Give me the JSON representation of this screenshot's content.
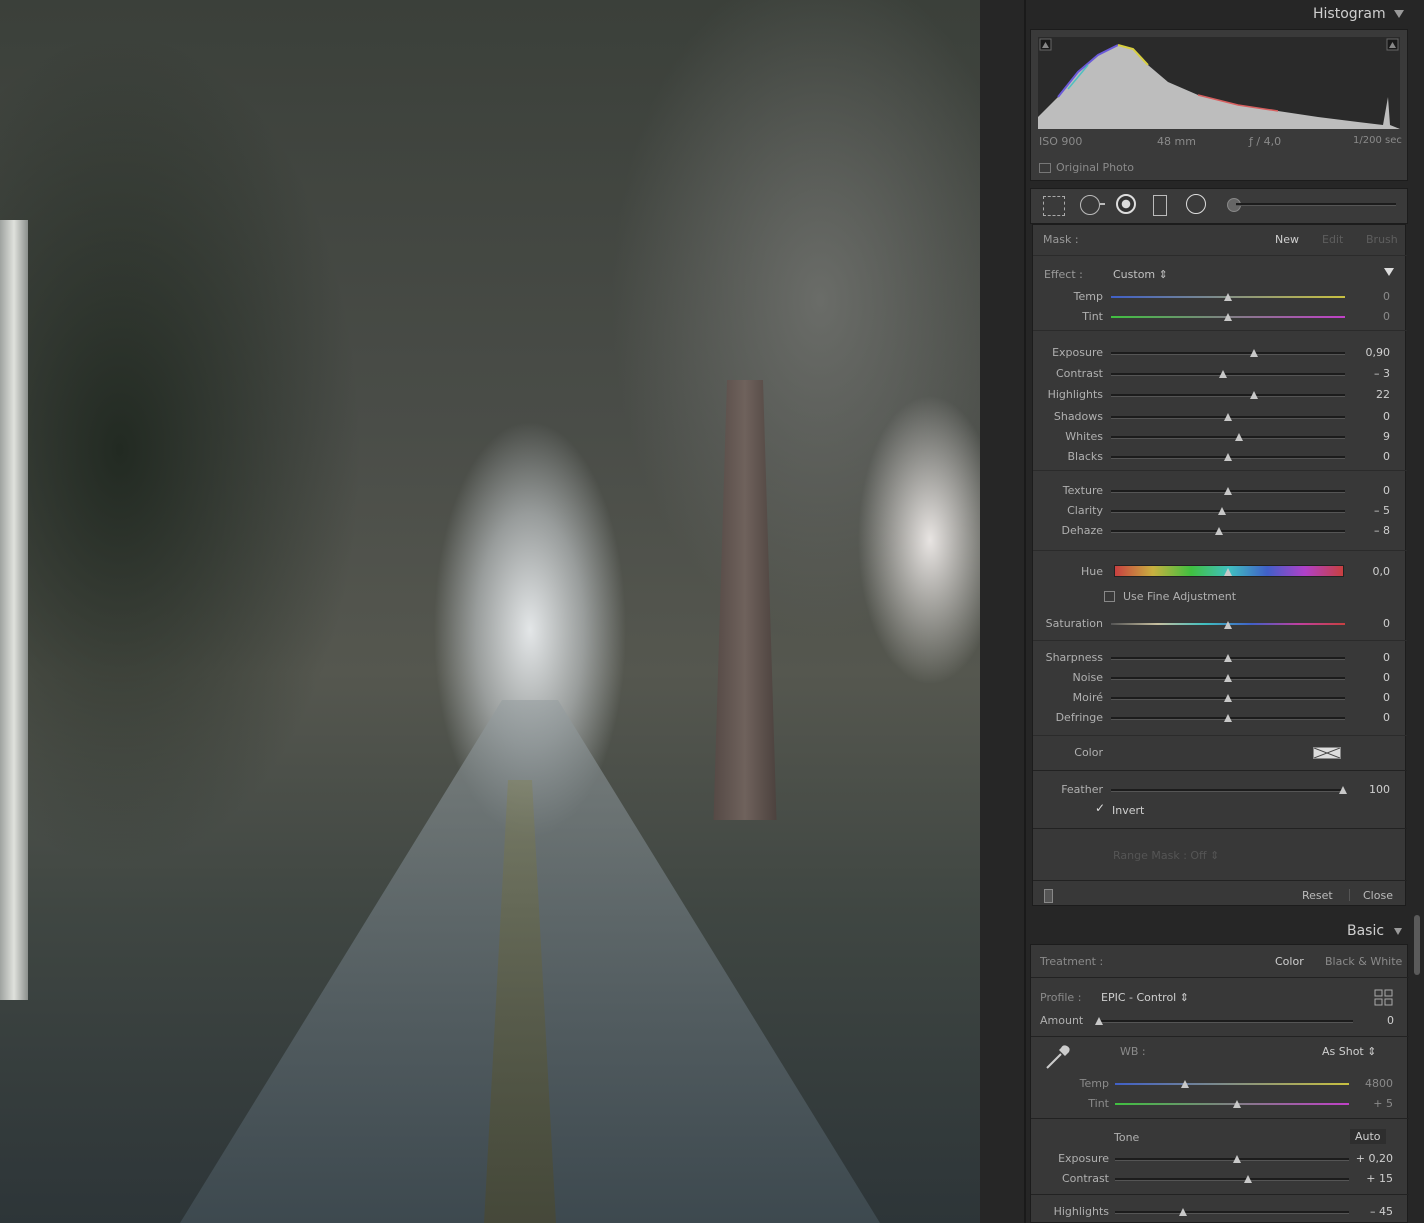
{
  "histogram": {
    "title": "Histogram",
    "iso": "ISO 900",
    "focal": "48 mm",
    "aperture": "ƒ / 4,0",
    "shutter": "1/200 sec",
    "original_photo": "Original Photo"
  },
  "mask": {
    "label": "Mask :",
    "new": "New",
    "edit": "Edit",
    "brush": "Brush"
  },
  "effect": {
    "label": "Effect :",
    "value": "Custom ⇕"
  },
  "sliders": [
    {
      "label": "Temp",
      "value": "0",
      "level": 0.5
    },
    {
      "label": "Tint",
      "value": "0",
      "level": 0.5
    },
    {
      "label": "Exposure",
      "value": "0,90",
      "level": 0.61
    },
    {
      "label": "Contrast",
      "value": "– 3",
      "level": 0.48
    },
    {
      "label": "Highlights",
      "value": "22",
      "level": 0.61
    },
    {
      "label": "Shadows",
      "value": "0",
      "level": 0.5
    },
    {
      "label": "Whites",
      "value": "9",
      "level": 0.545
    },
    {
      "label": "Blacks",
      "value": "0",
      "level": 0.5
    },
    {
      "label": "Texture",
      "value": "0",
      "level": 0.5
    },
    {
      "label": "Clarity",
      "value": "– 5",
      "level": 0.475
    },
    {
      "label": "Dehaze",
      "value": "– 8",
      "level": 0.46
    }
  ],
  "hue": {
    "label": "Hue",
    "value": "0,0",
    "level": 0.5
  },
  "fine_adjustment": "Use Fine Adjustment",
  "saturation": {
    "label": "Saturation",
    "value": "0",
    "level": 0.5
  },
  "detail_sliders": [
    {
      "label": "Sharpness",
      "value": "0",
      "level": 0.5
    },
    {
      "label": "Noise",
      "value": "0",
      "level": 0.5
    },
    {
      "label": "Moiré",
      "value": "0",
      "level": 0.5
    },
    {
      "label": "Defringe",
      "value": "0",
      "level": 0.5
    }
  ],
  "color_label": "Color",
  "feather": {
    "label": "Feather",
    "value": "100",
    "level": 0.99
  },
  "invert": "Invert",
  "range_mask": "Range Mask :  Off  ⇕",
  "footer": {
    "reset": "Reset",
    "close": "Close"
  },
  "basic": {
    "title": "Basic",
    "treatment_label": "Treatment :",
    "color": "Color",
    "bw": "Black & White",
    "profile_label": "Profile :",
    "profile_value": "EPIC - Control ⇕",
    "amount": {
      "label": "Amount",
      "value": "0",
      "level": 0.0
    },
    "wb_label": "WB :",
    "wb_value": "As Shot ⇕",
    "temp": {
      "label": "Temp",
      "value": "4800",
      "level": 0.3
    },
    "tint": {
      "label": "Tint",
      "value": "+ 5",
      "level": 0.52
    },
    "tone_label": "Tone",
    "auto": "Auto",
    "exposure": {
      "label": "Exposure",
      "value": "+ 0,20",
      "level": 0.52
    },
    "contrast": {
      "label": "Contrast",
      "value": "+ 15",
      "level": 0.57
    },
    "highlights": {
      "label": "Highlights",
      "value": "– 45",
      "level": 0.29
    }
  },
  "colors": {
    "panel_bg": "#3a3a3a",
    "app_bg": "#262626",
    "text": "#b0b0b0"
  }
}
